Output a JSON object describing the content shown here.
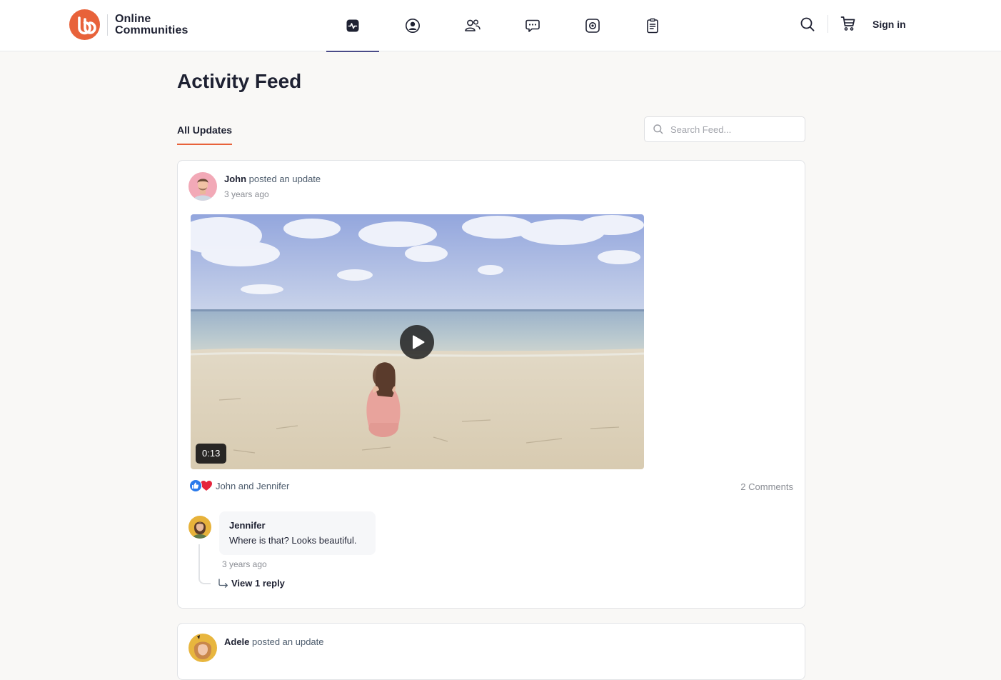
{
  "brand": {
    "name_line1": "Online",
    "name_line2": "Communities",
    "accent": "#e8623a"
  },
  "nav": {
    "items": [
      {
        "icon": "activity-icon",
        "active": true
      },
      {
        "icon": "profile-icon",
        "active": false
      },
      {
        "icon": "groups-icon",
        "active": false
      },
      {
        "icon": "forums-icon",
        "active": false
      },
      {
        "icon": "media-icon",
        "active": false
      },
      {
        "icon": "docs-icon",
        "active": false
      }
    ]
  },
  "header": {
    "sign_in": "Sign in"
  },
  "page": {
    "title": "Activity Feed",
    "tab": "All Updates",
    "search_placeholder": "Search Feed..."
  },
  "post": {
    "author": "John",
    "action": " posted an update",
    "time": "3 years ago",
    "video_duration": "0:13",
    "reactions_text": "John and Jennifer",
    "comments_count": "2 Comments",
    "comment": {
      "author": "Jennifer",
      "text": "Where is that? Looks beautiful.",
      "time": "3 years ago",
      "view_replies": "View 1 reply"
    }
  },
  "post2": {
    "author": "Adele",
    "action": " posted an update"
  }
}
